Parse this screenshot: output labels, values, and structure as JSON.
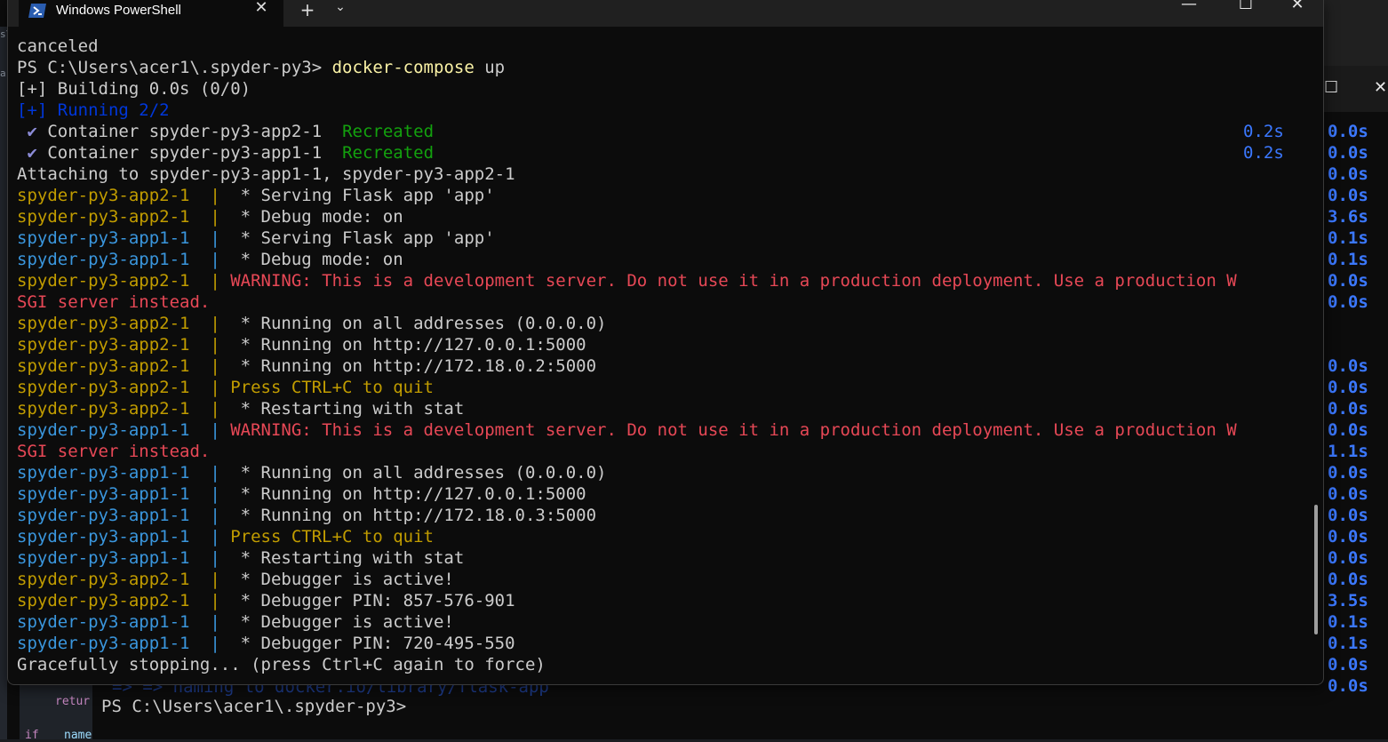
{
  "window": {
    "tab_title": "Windows PowerShell",
    "new_tab": "+",
    "dropdown": "⌄",
    "close_tab": "✕",
    "minimize": "—",
    "maximize": "☐",
    "close": "✕"
  },
  "terminal_lines": [
    [
      {
        "t": "canceled",
        "c": "c-white"
      }
    ],
    [
      {
        "t": "PS C:\\Users\\acer1\\.spyder-py3> ",
        "c": "c-white"
      },
      {
        "t": "docker-compose",
        "c": "c-cmd"
      },
      {
        "t": " up",
        "c": "c-white"
      }
    ],
    [
      {
        "t": "[+] Building 0.0s (0/0)",
        "c": "c-white"
      }
    ],
    [
      {
        "t": "[+] Running 2/2",
        "c": "c-darkblue"
      }
    ],
    [
      {
        "t": " ✔ ",
        "c": "c-check"
      },
      {
        "t": "Container spyder-py3-app2-1  ",
        "c": "c-white"
      },
      {
        "t": "Recreated",
        "c": "c-green"
      }
    ],
    [
      {
        "t": " ✔ ",
        "c": "c-check"
      },
      {
        "t": "Container spyder-py3-app1-1  ",
        "c": "c-white"
      },
      {
        "t": "Recreated",
        "c": "c-green"
      }
    ],
    [
      {
        "t": "Attaching to spyder-py3-app1-1, spyder-py3-app2-1",
        "c": "c-white"
      }
    ],
    [
      {
        "t": "spyder-py3-app2-1  | ",
        "c": "c-yellow"
      },
      {
        "t": " * Serving Flask app 'app'",
        "c": "c-white"
      }
    ],
    [
      {
        "t": "spyder-py3-app2-1  | ",
        "c": "c-yellow"
      },
      {
        "t": " * Debug mode: on",
        "c": "c-white"
      }
    ],
    [
      {
        "t": "spyder-py3-app1-1  | ",
        "c": "c-blue"
      },
      {
        "t": " * Serving Flask app 'app'",
        "c": "c-white"
      }
    ],
    [
      {
        "t": "spyder-py3-app1-1  | ",
        "c": "c-blue"
      },
      {
        "t": " * Debug mode: on",
        "c": "c-white"
      }
    ],
    [
      {
        "t": "spyder-py3-app2-1  | ",
        "c": "c-yellow"
      },
      {
        "t": "WARNING: This is a development server. Do not use it in a production deployment. Use a production W",
        "c": "c-red"
      }
    ],
    [
      {
        "t": "SGI server instead.",
        "c": "c-red"
      }
    ],
    [
      {
        "t": "spyder-py3-app2-1  | ",
        "c": "c-yellow"
      },
      {
        "t": " * Running on all addresses (0.0.0.0)",
        "c": "c-white"
      }
    ],
    [
      {
        "t": "spyder-py3-app2-1  | ",
        "c": "c-yellow"
      },
      {
        "t": " * Running on http://127.0.0.1:5000",
        "c": "c-white"
      }
    ],
    [
      {
        "t": "spyder-py3-app2-1  | ",
        "c": "c-yellow"
      },
      {
        "t": " * Running on http://172.18.0.2:5000",
        "c": "c-white"
      }
    ],
    [
      {
        "t": "spyder-py3-app2-1  | ",
        "c": "c-yellow"
      },
      {
        "t": "Press CTRL+C to quit",
        "c": "c-yellow"
      }
    ],
    [
      {
        "t": "spyder-py3-app2-1  | ",
        "c": "c-yellow"
      },
      {
        "t": " * Restarting with stat",
        "c": "c-white"
      }
    ],
    [
      {
        "t": "spyder-py3-app1-1  | ",
        "c": "c-blue"
      },
      {
        "t": "WARNING: This is a development server. Do not use it in a production deployment. Use a production W",
        "c": "c-red"
      }
    ],
    [
      {
        "t": "SGI server instead.",
        "c": "c-red"
      }
    ],
    [
      {
        "t": "spyder-py3-app1-1  | ",
        "c": "c-blue"
      },
      {
        "t": " * Running on all addresses (0.0.0.0)",
        "c": "c-white"
      }
    ],
    [
      {
        "t": "spyder-py3-app1-1  | ",
        "c": "c-blue"
      },
      {
        "t": " * Running on http://127.0.0.1:5000",
        "c": "c-white"
      }
    ],
    [
      {
        "t": "spyder-py3-app1-1  | ",
        "c": "c-blue"
      },
      {
        "t": " * Running on http://172.18.0.3:5000",
        "c": "c-white"
      }
    ],
    [
      {
        "t": "spyder-py3-app1-1  | ",
        "c": "c-blue"
      },
      {
        "t": "Press CTRL+C to quit",
        "c": "c-yellow"
      }
    ],
    [
      {
        "t": "spyder-py3-app1-1  | ",
        "c": "c-blue"
      },
      {
        "t": " * Restarting with stat",
        "c": "c-white"
      }
    ],
    [
      {
        "t": "spyder-py3-app2-1  | ",
        "c": "c-yellow"
      },
      {
        "t": " * Debugger is active!",
        "c": "c-white"
      }
    ],
    [
      {
        "t": "spyder-py3-app2-1  | ",
        "c": "c-yellow"
      },
      {
        "t": " * Debugger PIN: 857-576-901",
        "c": "c-white"
      }
    ],
    [
      {
        "t": "spyder-py3-app1-1  | ",
        "c": "c-blue"
      },
      {
        "t": " * Debugger is active!",
        "c": "c-white"
      }
    ],
    [
      {
        "t": "spyder-py3-app1-1  | ",
        "c": "c-blue"
      },
      {
        "t": " * Debugger PIN: 720-495-550",
        "c": "c-white"
      }
    ],
    [
      {
        "t": "Gracefully stopping... (press Ctrl+C again to force)",
        "c": "c-white"
      }
    ]
  ],
  "container_times": [
    "0.2s",
    "0.2s"
  ],
  "background": {
    "maximize": "☐",
    "close": "✕",
    "times": [
      "0.0s",
      "0.0s",
      "0.0s",
      "0.0s",
      "3.6s",
      "0.1s",
      "0.1s",
      "0.0s",
      "0.0s",
      "",
      "",
      "0.0s",
      "0.0s",
      "0.0s",
      "0.0s",
      "1.1s",
      "0.0s",
      "0.0s",
      "0.0s",
      "0.0s",
      "0.0s",
      "0.0s",
      "3.5s",
      "0.1s",
      "0.1s",
      "0.0s",
      "0.0s"
    ],
    "faded_line": "=> => naming to docker.io/library/flask-app",
    "prompt": "PS C:\\Users\\acer1\\.spyder-py3>",
    "left_text_1": "s\\",
    "left_text_2": "a",
    "code_return": "retur",
    "code_if": "if",
    "code_name": "name"
  }
}
